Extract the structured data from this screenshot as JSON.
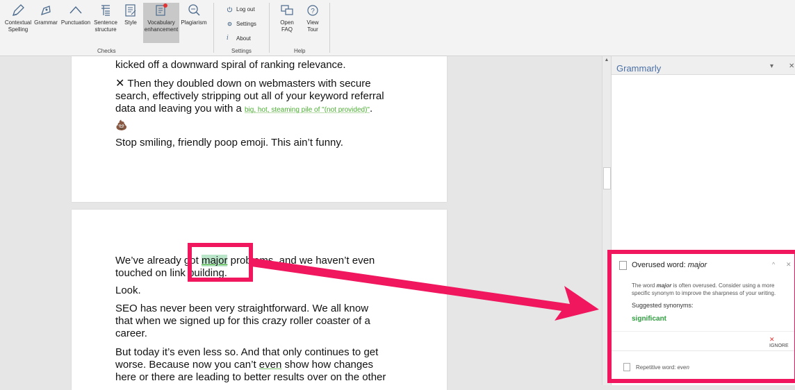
{
  "ribbon": {
    "checks": [
      {
        "label1": "Contextual",
        "label2": "Spelling",
        "icon": "pen-icon"
      },
      {
        "label1": "Grammar",
        "label2": "",
        "icon": "nib-icon"
      },
      {
        "label1": "Punctuation",
        "label2": "",
        "icon": "caret-icon"
      },
      {
        "label1": "Sentence",
        "label2": "structure",
        "icon": "paragraph-icon"
      },
      {
        "label1": "Style",
        "label2": "",
        "icon": "style-doc-icon"
      },
      {
        "label1": "Vocabulary",
        "label2": "enhancement",
        "icon": "vocabulary-book-icon"
      },
      {
        "label1": "Plagiarism",
        "label2": "",
        "icon": "magnifier-icon"
      }
    ],
    "checks_group": "Checks",
    "settings_items": [
      {
        "label": "Log out",
        "icon": "power-icon"
      },
      {
        "label": "Settings",
        "icon": "gear-icon"
      },
      {
        "label": "About",
        "icon": "info-icon"
      }
    ],
    "settings_group": "Settings",
    "help_items": [
      {
        "label1": "Open",
        "label2": "FAQ",
        "icon": "chat-bubbles-icon"
      },
      {
        "label1": "View",
        "label2": "Tour",
        "icon": "question-circle-icon"
      }
    ],
    "help_group": "Help"
  },
  "document": {
    "p1_line": "kicked off a downward spiral of ranking relevance.",
    "p2_a": "Then they doubled down on webmasters with secure",
    "p2_b": "search, effectively stripping out all of your keyword referral",
    "p2_c": "data and leaving you with a ",
    "p2_link": "big, hot, steaming pile of \"(not provided)\"",
    "p2_d": ".",
    "p3": "Stop smiling, friendly poop emoji. This ain’t funny.",
    "p4_a": "We’ve already got ",
    "p4_highlight": "major",
    "p4_b": " problems, and we haven’t even",
    "p4_c": "touched on link building.",
    "p5": "Look.",
    "p6_a": "SEO has never been very straightforward. We all know",
    "p6_b": "that when we signed up for this crazy roller coaster of a",
    "p6_c": "career.",
    "p7_a": "But today it’s even less so. And that only continues to get",
    "p7_b": "worse. Because now you can’t ",
    "p7_even": "even",
    "p7_c": " show how changes",
    "p7_d": "here or there are leading to better results over on the other"
  },
  "pane": {
    "title": "Grammarly",
    "card_title_prefix": "Overused word: ",
    "card_word": "major",
    "card_body_a": "The word ",
    "card_body_word": "major",
    "card_body_b": " is often overused. Consider using a more specific synonym to improve the sharpness of your writing.",
    "synonyms_label": "Suggested synonyms:",
    "synonym": "significant",
    "ignore_label": "IGNORE",
    "card2_title_prefix": "Repetitive word: ",
    "card2_word": "even"
  },
  "colors": {
    "accent_pink": "#f0175f",
    "grammarly_green": "#2e9e3e",
    "pane_title_blue": "#4a6fa5"
  }
}
